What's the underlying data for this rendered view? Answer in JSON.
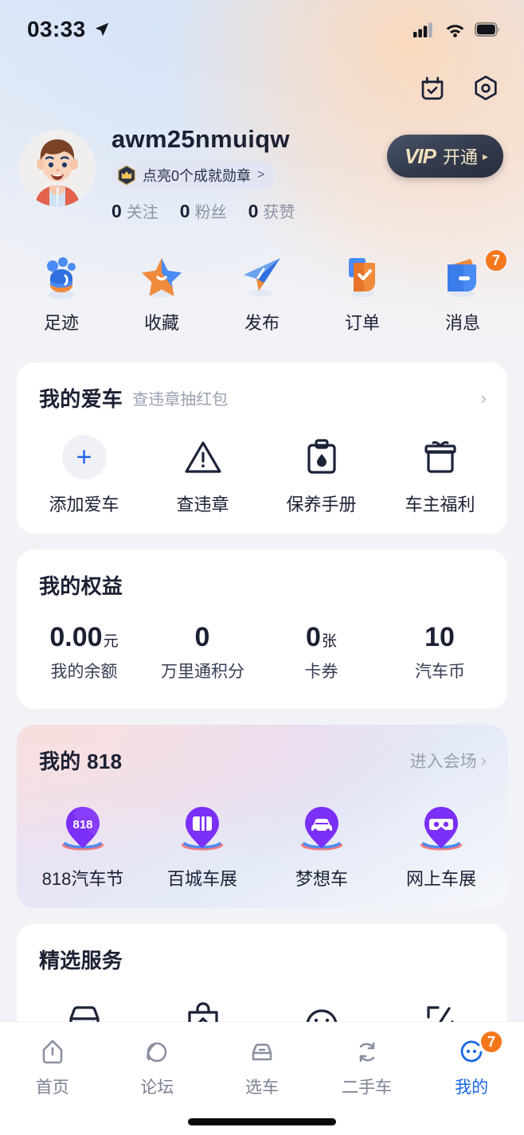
{
  "status_bar": {
    "time": "03:33",
    "location_icon": "location-arrow-icon",
    "signal_icon": "cellular-signal-icon",
    "wifi_icon": "wifi-icon",
    "battery_icon": "battery-icon"
  },
  "header": {
    "calendar_icon": "calendar-check-icon",
    "settings_icon": "hexagon-settings-icon",
    "avatar_alt": "user-avatar",
    "username": "awm25nmuiqw",
    "badge": {
      "icon": "crown-medal-icon",
      "text": "点亮0个成就勋章",
      "chevron": ">"
    },
    "stats": [
      {
        "num": "0",
        "label": "关注"
      },
      {
        "num": "0",
        "label": "粉丝"
      },
      {
        "num": "0",
        "label": "获赞"
      }
    ],
    "vip": {
      "word": "VIP",
      "label": "开通",
      "arrow": "▸"
    }
  },
  "quick_actions": [
    {
      "label": "足迹",
      "icon": "footprint-icon",
      "badge": ""
    },
    {
      "label": "收藏",
      "icon": "star-favorite-icon",
      "badge": ""
    },
    {
      "label": "发布",
      "icon": "send-publish-icon",
      "badge": ""
    },
    {
      "label": "订单",
      "icon": "order-checklist-icon",
      "badge": ""
    },
    {
      "label": "消息",
      "icon": "message-wallet-icon",
      "badge": "7"
    }
  ],
  "my_car": {
    "title": "我的爱车",
    "subtitle": "查违章抽红包",
    "chevron": "›",
    "items": [
      {
        "label": "添加爱车",
        "icon": "plus-add-icon"
      },
      {
        "label": "查违章",
        "icon": "warning-triangle-icon"
      },
      {
        "label": "保养手册",
        "icon": "clipboard-oil-icon"
      },
      {
        "label": "车主福利",
        "icon": "gift-box-icon"
      }
    ]
  },
  "benefits": {
    "title": "我的权益",
    "items": [
      {
        "value": "0.00",
        "unit": "元",
        "label": "我的余额"
      },
      {
        "value": "0",
        "unit": "",
        "label": "万里通积分"
      },
      {
        "value": "0",
        "unit": "张",
        "label": "卡券"
      },
      {
        "value": "10",
        "unit": "",
        "label": "汽车币"
      }
    ]
  },
  "festival_818": {
    "title": "我的 818",
    "more_label": "进入会场",
    "more_chevron": "›",
    "items": [
      {
        "label": "818汽车节",
        "icon": "818-logo-icon"
      },
      {
        "label": "百城车展",
        "icon": "ticket-icon"
      },
      {
        "label": "梦想车",
        "icon": "car-icon"
      },
      {
        "label": "网上车展",
        "icon": "vr-goggles-icon"
      }
    ]
  },
  "featured": {
    "title": "精选服务",
    "items": [
      {
        "icon": "car-front-service-icon"
      },
      {
        "icon": "bag-service-icon"
      },
      {
        "icon": "helmet-service-icon"
      },
      {
        "icon": "edit-frame-service-icon"
      }
    ]
  },
  "tabbar": {
    "tabs": [
      {
        "label": "首页",
        "icon": "home-icon",
        "active": false,
        "badge": ""
      },
      {
        "label": "论坛",
        "icon": "forum-planet-icon",
        "active": false,
        "badge": ""
      },
      {
        "label": "选车",
        "icon": "choose-car-icon",
        "active": false,
        "badge": ""
      },
      {
        "label": "二手车",
        "icon": "used-car-refresh-icon",
        "active": false,
        "badge": ""
      },
      {
        "label": "我的",
        "icon": "profile-face-icon",
        "active": true,
        "badge": "7"
      }
    ]
  },
  "colors": {
    "accent_blue": "#1668e3",
    "badge_orange": "#f5771b",
    "text_dark": "#1b2033",
    "text_muted": "#9aa0b0",
    "vip_gold": "#f3e2bd",
    "purple_818": "#7b2ff7"
  }
}
